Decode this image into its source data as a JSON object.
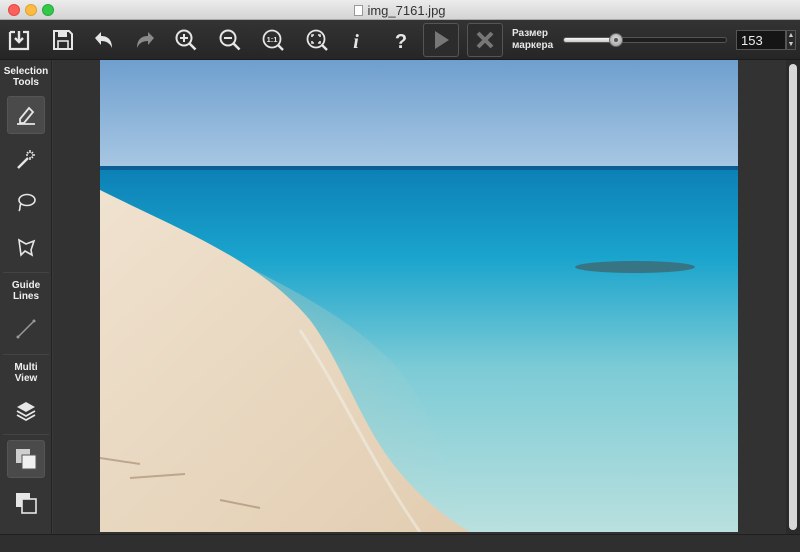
{
  "window": {
    "title": "img_7161.jpg"
  },
  "toolbar": {
    "marker_size_label_line1": "Размер",
    "marker_size_label_line2": "маркера",
    "marker_size_value": "153",
    "marker_size_fraction": 0.32,
    "buttons": [
      "export-icon",
      "save-icon",
      "undo-icon",
      "redo-icon",
      "zoom-in-icon",
      "zoom-out-icon",
      "actual-size-icon",
      "fit-to-window-icon",
      "info-icon",
      "help-icon",
      "play-icon",
      "cancel-icon"
    ],
    "actual_size_glyph": "1:1",
    "info_glyph": "i",
    "help_glyph": "?"
  },
  "sidebar": {
    "selection_tools_line1": "Selection",
    "selection_tools_line2": "Tools",
    "guide_lines_line1": "Guide",
    "guide_lines_line2": "Lines",
    "multi_view_line1": "Multi",
    "multi_view_line2": "View",
    "tools": [
      "pencil-icon",
      "magic-wand-icon",
      "lasso-icon",
      "polygon-lasso-icon",
      "line-icon",
      "layers-icon",
      "front-layer-icon",
      "back-layer-icon"
    ]
  },
  "colors": {
    "toolbar_bg": "#2b2b2b",
    "sidebar_bg": "#353535",
    "icon": "#e6e6e6"
  }
}
